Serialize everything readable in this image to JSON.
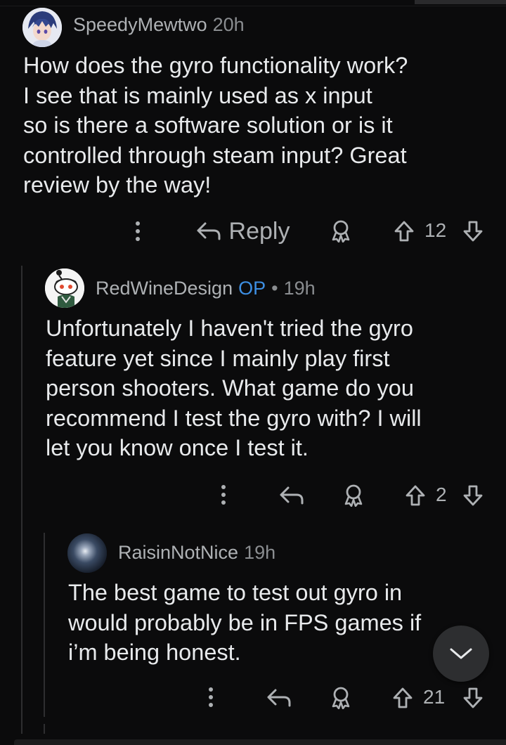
{
  "comments": [
    {
      "username": "SpeedyMewtwo",
      "age": "20h",
      "lines": [
        "How does the gyro functionality work?",
        "I see that is mainly used as x input",
        "so is there a software solution or is it",
        "controlled through steam input? Great",
        "review by the way!"
      ],
      "reply_label": "Reply",
      "score": "12"
    },
    {
      "username": "RedWineDesign",
      "op_badge": "OP",
      "separator": "•",
      "age": "19h",
      "lines": [
        "Unfortunately I haven't tried the gyro",
        "feature yet since I mainly play first",
        "person shooters. What game do you",
        "recommend I test the gyro with? I will",
        "let you know once I test it."
      ],
      "score": "2"
    },
    {
      "username": "RaisinNotNice",
      "age": "19h",
      "lines": [
        "The best game to test out gyro in",
        "would probably be in FPS games if",
        "i’m being honest."
      ],
      "score": "21"
    }
  ],
  "icons": {
    "more": "more-options-icon",
    "reply": "reply-arrow-icon",
    "award": "award-icon",
    "upvote": "upvote-icon",
    "downvote": "downvote-icon",
    "scroll": "chevron-down-icon"
  },
  "colors": {
    "background": "#0b0b0c",
    "text": "#e8eaec",
    "muted": "#aeb1b4",
    "op_badge": "#3d8fe3"
  }
}
